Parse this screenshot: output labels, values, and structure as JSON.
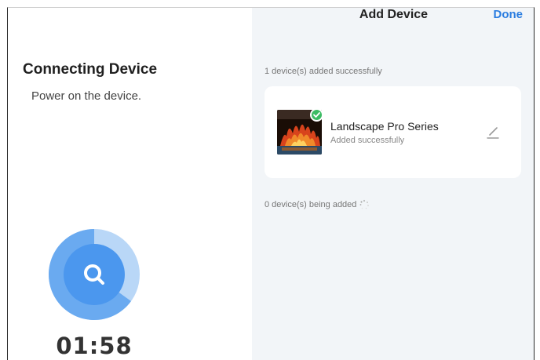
{
  "left_panel": {
    "title": "Connecting Device",
    "subtitle": "Power on the device.",
    "timer": "01:58",
    "scan_icon": "search-icon"
  },
  "header": {
    "title": "Add Device",
    "done_label": "Done"
  },
  "added_section": {
    "count_text": "1 device(s) added successfully",
    "device": {
      "name": "Landscape Pro Series",
      "status": "Added successfully",
      "thumbnail": "fireplace-image",
      "badge_icon": "check-badge-icon",
      "edit_icon": "pencil-icon"
    }
  },
  "adding_section": {
    "count_text": "0 device(s) being added",
    "loading_icon": "spinner-icon"
  },
  "colors": {
    "accent": "#2b7de0",
    "success": "#3cbb63",
    "panel_bg": "#f2f5f8",
    "scanner_outer": "#b9d7f7",
    "scanner_inner": "#4b97ee"
  }
}
